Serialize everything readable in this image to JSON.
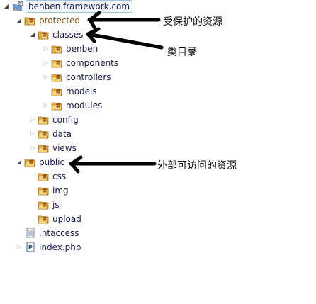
{
  "tree": {
    "root": {
      "label": "benben.framework.com",
      "icon": "php-project-icon"
    },
    "items": [
      {
        "label": "protected",
        "icon": "folder-package-warning-icon",
        "state": "expanded",
        "color": "#7a5418"
      },
      {
        "label": "classes",
        "icon": "folder-package-warning-icon",
        "state": "expanded"
      },
      {
        "label": "benben",
        "icon": "folder-package-warning-icon",
        "state": "collapsed"
      },
      {
        "label": "components",
        "icon": "folder-package-icon",
        "state": "collapsed"
      },
      {
        "label": "controllers",
        "icon": "folder-package-icon",
        "state": "collapsed"
      },
      {
        "label": "models",
        "icon": "folder-package-icon",
        "state": "leaf"
      },
      {
        "label": "modules",
        "icon": "folder-package-icon",
        "state": "collapsed"
      },
      {
        "label": "config",
        "icon": "folder-package-icon",
        "state": "collapsed"
      },
      {
        "label": "data",
        "icon": "folder-package-icon",
        "state": "collapsed"
      },
      {
        "label": "views",
        "icon": "folder-package-icon",
        "state": "collapsed"
      },
      {
        "label": "public",
        "icon": "folder-package-icon",
        "state": "expanded"
      },
      {
        "label": "css",
        "icon": "folder-package-icon",
        "state": "leaf"
      },
      {
        "label": "img",
        "icon": "folder-package-icon",
        "state": "leaf"
      },
      {
        "label": "js",
        "icon": "folder-package-icon",
        "state": "leaf"
      },
      {
        "label": "upload",
        "icon": "folder-package-icon",
        "state": "leaf"
      },
      {
        "label": ".htaccess",
        "icon": "text-file-icon",
        "state": "leaf"
      },
      {
        "label": "index.php",
        "icon": "php-file-icon",
        "state": "collapsed"
      }
    ]
  },
  "annotations": {
    "protected": "受保护的资源",
    "classes": "类目录",
    "public": "外部可访问的资源"
  }
}
